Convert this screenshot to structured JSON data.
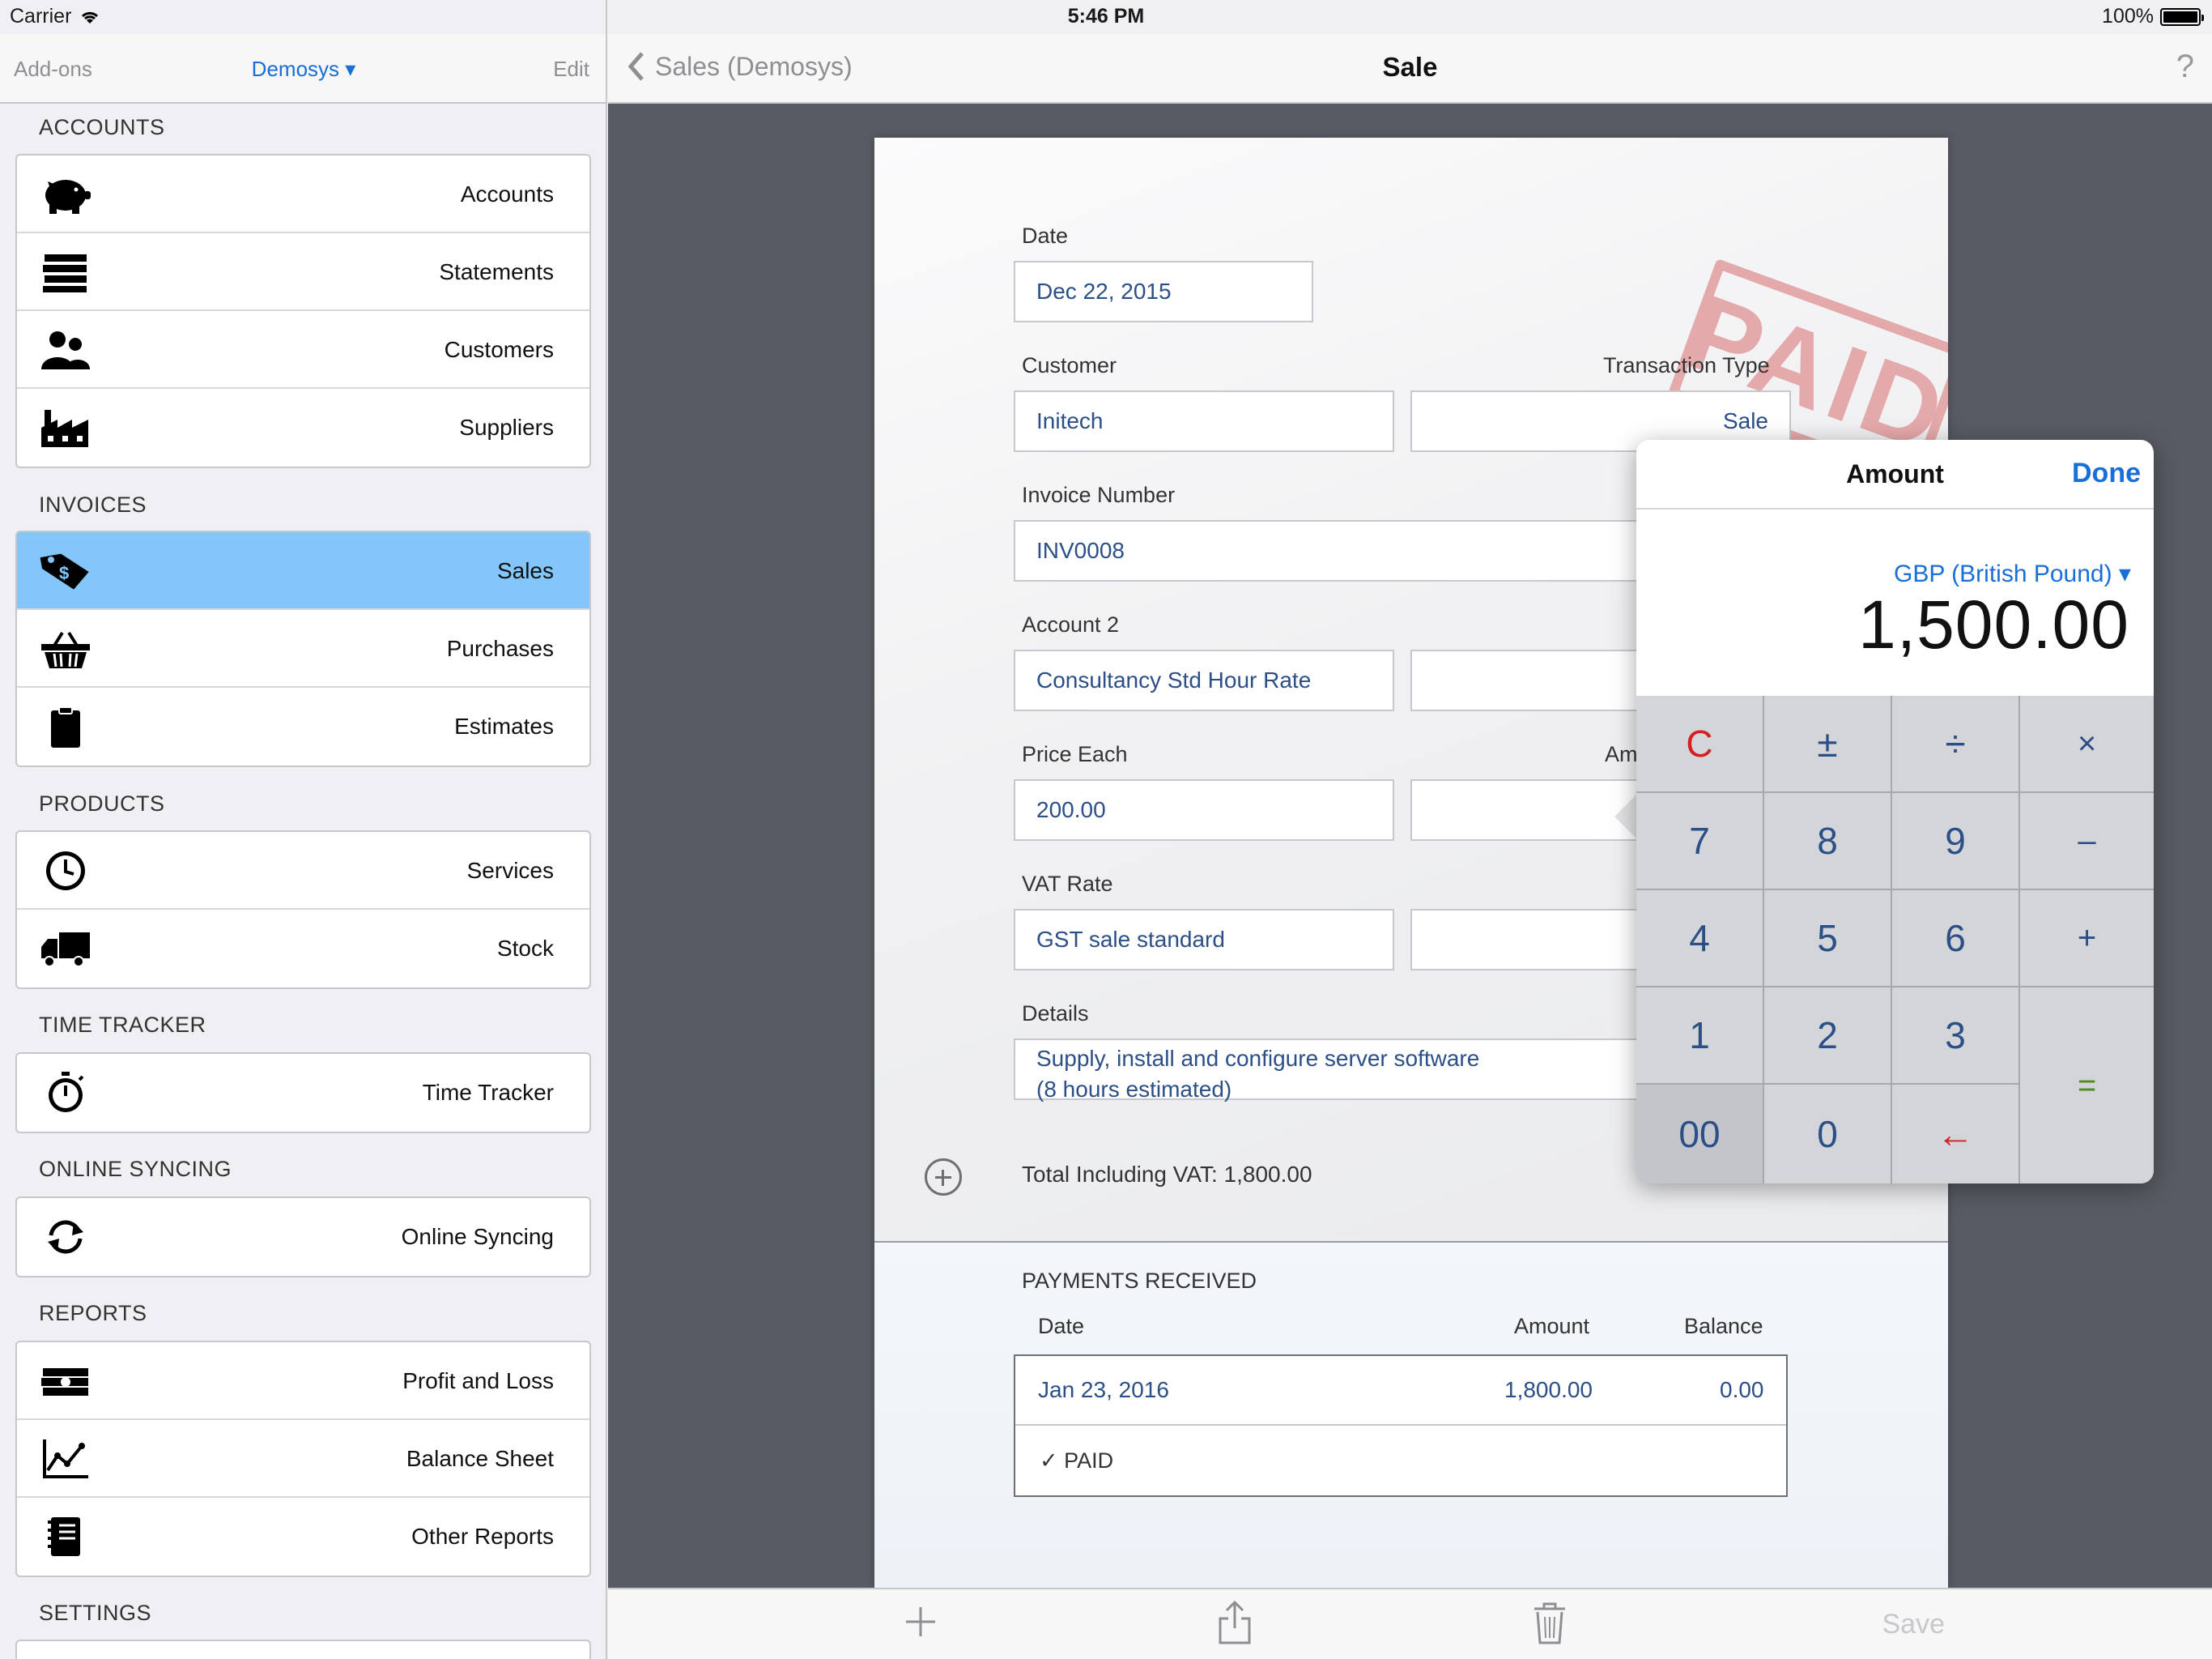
{
  "status_bar": {
    "carrier": "Carrier",
    "time": "5:46 PM",
    "battery": "100%"
  },
  "sidebar": {
    "nav": {
      "left": "Add-ons",
      "title": "Demosys ▾",
      "right": "Edit"
    },
    "sections": [
      {
        "header": "ACCOUNTS",
        "items": [
          {
            "label": "Accounts",
            "icon": "piggy-bank-icon"
          },
          {
            "label": "Statements",
            "icon": "statements-stack-icon"
          },
          {
            "label": "Customers",
            "icon": "customers-icon"
          },
          {
            "label": "Suppliers",
            "icon": "factory-icon"
          }
        ]
      },
      {
        "header": "INVOICES",
        "items": [
          {
            "label": "Sales",
            "icon": "price-tag-icon",
            "selected": true
          },
          {
            "label": "Purchases",
            "icon": "basket-icon"
          },
          {
            "label": "Estimates",
            "icon": "clipboard-icon"
          }
        ]
      },
      {
        "header": "PRODUCTS",
        "items": [
          {
            "label": "Services",
            "icon": "clock-icon"
          },
          {
            "label": "Stock",
            "icon": "truck-icon"
          }
        ]
      },
      {
        "header": "TIME TRACKER",
        "items": [
          {
            "label": "Time Tracker",
            "icon": "stopwatch-icon"
          }
        ]
      },
      {
        "header": "ONLINE SYNCING",
        "items": [
          {
            "label": "Online Syncing",
            "icon": "sync-icon"
          }
        ]
      },
      {
        "header": "REPORTS",
        "items": [
          {
            "label": "Profit and Loss",
            "icon": "cash-icon"
          },
          {
            "label": "Balance Sheet",
            "icon": "line-chart-icon"
          },
          {
            "label": "Other Reports",
            "icon": "notebook-icon"
          }
        ]
      },
      {
        "header": "SETTINGS",
        "items": []
      }
    ]
  },
  "main_nav": {
    "back_label": "Sales (Demosys)",
    "title": "Sale",
    "help": "?"
  },
  "form": {
    "stamp": "PAID",
    "date": {
      "label": "Date",
      "value": "Dec 22, 2015"
    },
    "customer": {
      "label": "Customer",
      "value": "Initech"
    },
    "transaction_type": {
      "label": "Transaction Type",
      "value": "Sale"
    },
    "invoice_number": {
      "label": "Invoice Number",
      "value": "INV0008"
    },
    "account2": {
      "label": "Account 2",
      "value": "Consultancy Std Hour Rate"
    },
    "price_each": {
      "label": "Price Each",
      "value": "200.00"
    },
    "amount_label_partial": "Am",
    "vat_rate": {
      "label": "VAT Rate",
      "value": "GST sale standard"
    },
    "details": {
      "label": "Details",
      "line1": "Supply, install and configure server software",
      "line2": "(8 hours estimated)"
    },
    "total": "Total Including VAT: 1,800.00"
  },
  "payments": {
    "header": "PAYMENTS RECEIVED",
    "columns": {
      "date": "Date",
      "amount": "Amount",
      "balance": "Balance"
    },
    "rows": [
      {
        "date": "Jan 23, 2016",
        "amount": "1,800.00",
        "balance": "0.00"
      }
    ],
    "status": "✓ PAID"
  },
  "toolbar": {
    "save": "Save"
  },
  "calculator": {
    "title": "Amount",
    "done": "Done",
    "currency": "GBP (British Pound) ▾",
    "display": "1,500.00",
    "keys": {
      "c": "C",
      "pm": "±",
      "div": "÷",
      "mul": "×",
      "k7": "7",
      "k8": "8",
      "k9": "9",
      "minus": "–",
      "k4": "4",
      "k5": "5",
      "k6": "6",
      "plus": "+",
      "k1": "1",
      "k2": "2",
      "k3": "3",
      "eq": "=",
      "k00": "00",
      "k0": "0",
      "back": "←"
    }
  }
}
